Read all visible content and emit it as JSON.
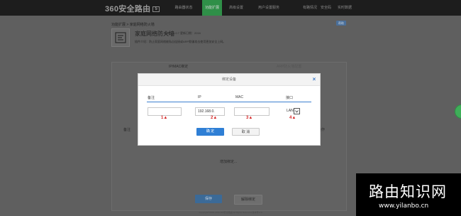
{
  "topbar": {
    "logo": "360安全路由",
    "logo_badge": "5",
    "nav": [
      "路由器状态",
      "功能扩展",
      "高级设置",
      "用户设置服务"
    ],
    "nav_right": [
      "有路情况",
      "安全码",
      "实时数据"
    ]
  },
  "page": {
    "breadcrumb": "功能扩展 > 家庭网络防火墙",
    "help_label": "帮助",
    "app": {
      "title": "家庭网络防火墙",
      "meta": "版本：1.0.7  更新日期：2016",
      "desc": "插件介绍：防止家庭网络被私自连接或ARP欺骗攻击使用更加安全上网。"
    },
    "tabs": [
      "IP/MAC绑定",
      "ARP防火墙配置"
    ],
    "stub_left": "备注",
    "stub_right": "操作",
    "add_device": "增加绑定...",
    "save_label": "保存",
    "unbind_label": "解除绑定",
    "footer": "Copyright©2006-2016 360安全路由 All Rights Reserved 版本号:0.0"
  },
  "modal": {
    "title": "绑定设备",
    "columns": {
      "name": "备注",
      "ip": "IP",
      "mac": "MAC",
      "interface": "接口"
    },
    "fields": {
      "name": "",
      "ip": "192.168.0.",
      "mac": ""
    },
    "interface_value": "LAN",
    "markers": [
      "1▲",
      "2▲",
      "3▲",
      "4▲"
    ],
    "ok_label": "确 定",
    "cancel_label": "取 消",
    "close_label": "×"
  },
  "watermark": {
    "main": "路由知识网",
    "url": "www.yilanbo.cn"
  },
  "colors": {
    "accent": "#2f7fd5",
    "active_tab": "#2f8f48",
    "marker": "#d62626"
  }
}
